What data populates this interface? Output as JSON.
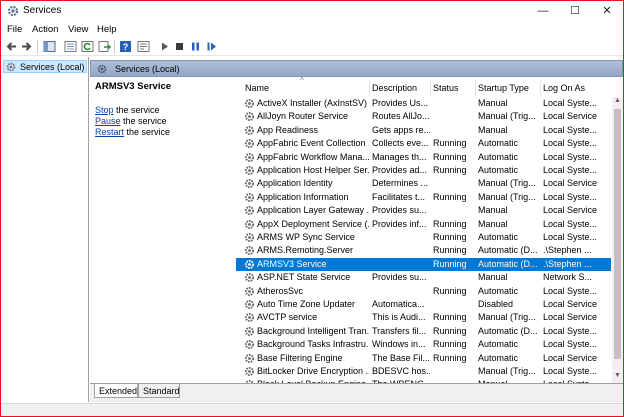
{
  "window": {
    "title": "Services",
    "controls": {
      "minimize": "—",
      "maximize": "☐",
      "close": "✕"
    }
  },
  "menu": {
    "items": [
      "File",
      "Action",
      "View",
      "Help"
    ]
  },
  "toolbar": {
    "icons": [
      "back-arrow-icon",
      "forward-arrow-icon",
      "show-hide-tree-icon",
      "console-tree-icon",
      "refresh-icon",
      "export-list-icon",
      "help-icon",
      "properties-icon",
      "start-service-icon",
      "stop-service-icon",
      "pause-service-icon",
      "restart-service-icon"
    ]
  },
  "tree": {
    "root_label": "Services (Local)"
  },
  "pane": {
    "header": "Services (Local)",
    "selected_service": "ARMSV3 Service",
    "actions": [
      {
        "link": "Stop",
        "rest": " the service"
      },
      {
        "link": "Pause",
        "rest": " the service"
      },
      {
        "link": "Restart",
        "rest": " the service"
      }
    ]
  },
  "table": {
    "columns": [
      "Name",
      "Description",
      "Status",
      "Startup Type",
      "Log On As"
    ],
    "rows": [
      [
        "ActiveX Installer (AxInstSV)",
        "Provides Us...",
        "",
        "Manual",
        "Local Syste..."
      ],
      [
        "AllJoyn Router Service",
        "Routes AllJo...",
        "",
        "Manual (Trig...",
        "Local Service"
      ],
      [
        "App Readiness",
        "Gets apps re...",
        "",
        "Manual",
        "Local Syste..."
      ],
      [
        "AppFabric Event Collection ...",
        "Collects eve...",
        "Running",
        "Automatic",
        "Local Syste..."
      ],
      [
        "AppFabric Workflow Mana...",
        "Manages th...",
        "Running",
        "Automatic",
        "Local Syste..."
      ],
      [
        "Application Host Helper Ser...",
        "Provides ad...",
        "Running",
        "Automatic",
        "Local Syste..."
      ],
      [
        "Application Identity",
        "Determines ...",
        "",
        "Manual (Trig...",
        "Local Service"
      ],
      [
        "Application Information",
        "Facilitates t...",
        "Running",
        "Manual (Trig...",
        "Local Syste..."
      ],
      [
        "Application Layer Gateway ...",
        "Provides su...",
        "",
        "Manual",
        "Local Service"
      ],
      [
        "AppX Deployment Service (...",
        "Provides inf...",
        "Running",
        "Manual",
        "Local Syste..."
      ],
      [
        "ARMS WP Sync Service",
        "",
        "Running",
        "Automatic",
        "Local Syste..."
      ],
      [
        "ARMS.Remoting.Server",
        "",
        "Running",
        "Automatic (D...",
        ".\\Stephen ..."
      ],
      [
        "ARMSV3 Service",
        "",
        "Running",
        "Automatic (D...",
        ".\\Stephen ..."
      ],
      [
        "ASP.NET State Service",
        "Provides su...",
        "",
        "Manual",
        "Network S..."
      ],
      [
        "AtherosSvc",
        "",
        "Running",
        "Automatic",
        "Local Syste..."
      ],
      [
        "Auto Time Zone Updater",
        "Automatica...",
        "",
        "Disabled",
        "Local Service"
      ],
      [
        "AVCTP service",
        "This is Audi...",
        "Running",
        "Manual (Trig...",
        "Local Service"
      ],
      [
        "Background Intelligent Tran...",
        "Transfers fil...",
        "Running",
        "Automatic (D...",
        "Local Syste..."
      ],
      [
        "Background Tasks Infrastru...",
        "Windows in...",
        "Running",
        "Automatic",
        "Local Syste..."
      ],
      [
        "Base Filtering Engine",
        "The Base Fil...",
        "Running",
        "Automatic",
        "Local Service"
      ],
      [
        "BitLocker Drive Encryption ...",
        "BDESVC hos...",
        "",
        "Manual (Trig...",
        "Local Syste..."
      ],
      [
        "Block Level Backup Engine ...",
        "The WBENG...",
        "",
        "Manual",
        "Local Syste..."
      ]
    ],
    "selected_index": 12
  },
  "tabs": [
    "Extended",
    "Standard"
  ],
  "colors": {
    "selection": "#0078d7",
    "link": "#0645ad",
    "header_band": "#a3b6d2"
  }
}
